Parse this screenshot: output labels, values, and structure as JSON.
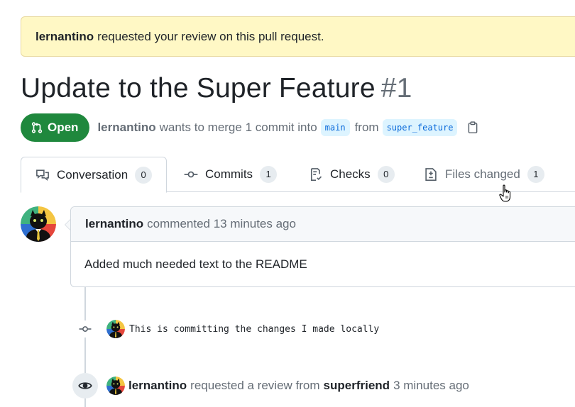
{
  "banner": {
    "user": "lernantino",
    "text": "requested your review on this pull request."
  },
  "pr": {
    "title": "Update to the Super Feature",
    "number": "#1",
    "state": "Open",
    "author": "lernantino",
    "merge_text": "wants to merge 1 commit into",
    "base_branch": "main",
    "from_text": "from",
    "head_branch": "super_feature"
  },
  "tabs": [
    {
      "label": "Conversation",
      "count": "0",
      "icon": "comment-discussion-icon"
    },
    {
      "label": "Commits",
      "count": "1",
      "icon": "git-commit-icon"
    },
    {
      "label": "Checks",
      "count": "0",
      "icon": "checklist-icon"
    },
    {
      "label": "Files changed",
      "count": "1",
      "icon": "file-diff-icon"
    }
  ],
  "comment": {
    "author": "lernantino",
    "meta": "commented 13 minutes ago",
    "body": "Added much needed text to the README"
  },
  "commit": {
    "message": "This is committing the changes I made locally"
  },
  "review_event": {
    "author": "lernantino",
    "text": "requested a review from",
    "reviewer": "superfriend",
    "time": "3 minutes ago"
  },
  "colors": {
    "open_green": "#1f883d",
    "banner_bg": "#fff8c5",
    "link_blue": "#0969da"
  }
}
